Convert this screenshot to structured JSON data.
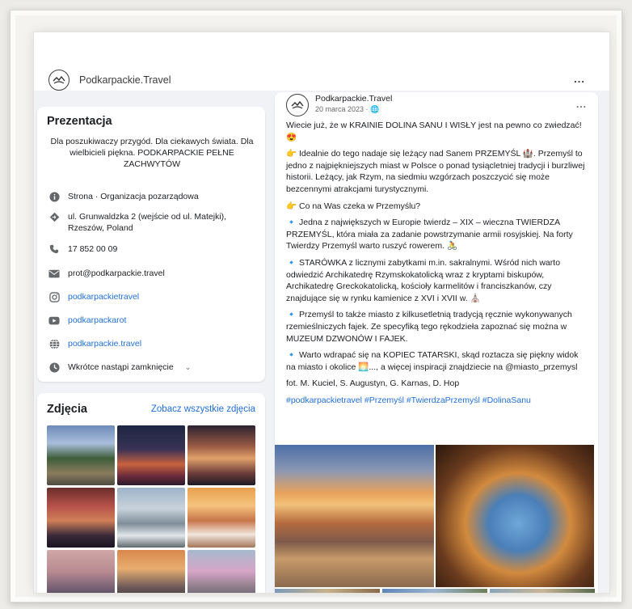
{
  "header": {
    "page_name": "Podkarpackie.Travel",
    "more": "..."
  },
  "intro": {
    "title": "Prezentacja",
    "text": "Dla poszukiwaczy przygód. Dla ciekawych świata. Dla wielbicieli piękna. PODKARPACKIE PEŁNE ZACHWYTÓW",
    "items": [
      {
        "icon": "info-icon",
        "text": "Strona · Organizacja pozarządowa"
      },
      {
        "icon": "location-pin-icon",
        "text": "ul. Grunwaldzka 2 (wejście od ul. Matejki), Rzeszów, Poland"
      },
      {
        "icon": "phone-icon",
        "text": "17 852 00 09"
      },
      {
        "icon": "email-icon",
        "text": "prot@podkarpackie.travel"
      },
      {
        "icon": "instagram-icon",
        "text": "podkarpackietravel"
      },
      {
        "icon": "youtube-icon",
        "text": "podkarpackarot"
      },
      {
        "icon": "globe-icon",
        "text": "podkarpackie.travel"
      },
      {
        "icon": "clock-icon",
        "text": "Wkrótce nastąpi zamknięcie"
      }
    ]
  },
  "photos": {
    "title": "Zdjęcia",
    "see_all": "Zobacz wszystkie zdjęcia"
  },
  "post": {
    "author": "Podkarpackie.Travel",
    "date": "20 marca 2023 · ",
    "more": "...",
    "paragraphs": [
      "Wiecie już, że w KRAINIE DOLINA SANU I WISŁY jest na pewno co zwiedzać! 😍",
      "👉 Idealnie do tego nadaje się leżący nad Sanem PRZEMYŚL 🏰. Przemyśl to jedno z najpiękniejszych miast w Polsce o ponad tysiącletniej tradycji i burzliwej historii. Leżący, jak Rzym, na siedmiu wzgórzach poszczycić się może bezcennymi atrakcjami turystycznymi.",
      "👉 Co na Was czeka w Przemyślu?",
      "🔹 Jedna z największych w Europie twierdz – XIX – wieczna TWIERDZA PRZEMYŚL, która miała za zadanie powstrzymanie armii rosyjskiej. Na forty Twierdzy Przemyśl warto ruszyć rowerem. 🚴",
      "🔹 STARÓWKA z licznymi zabytkami m.in. sakralnymi. Wśród nich warto odwiedzić Archikatedrę Rzymskokatolicką wraz z kryptami biskupów, Archikatedrę Greckokatolicką, kościoły karmelitów i franciszkanów, czy znajdujące się w rynku kamienice z XVI i XVII w. ⛪",
      "🔹 Przemyśl to także miasto z kilkusetletnią tradycją ręcznie wykonywanych rzemieślniczych fajek. Ze specyfiką tego rękodzieła zapoznać się można w MUZEUM DZWONÓW I FAJEK.",
      "🔹 Warto wdrapać się na KOPIEC TATARSKI, skąd roztacza się piękny widok na miasto i okolice 🌅..., a więcej inspiracji znajdziecie na @miasto_przemysl",
      "fot. M. Kuciel, S. Augustyn, G. Karnas, D. Hop"
    ],
    "hashtags": "#podkarpackietravel #Przemyśl #TwierdzaPrzemyśl #DolinaSanu"
  }
}
